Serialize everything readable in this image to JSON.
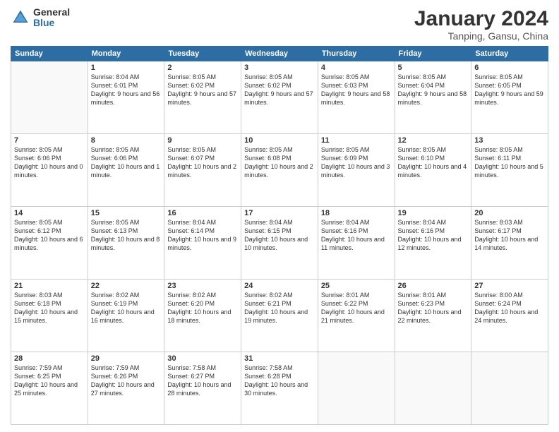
{
  "logo": {
    "general": "General",
    "blue": "Blue"
  },
  "title": "January 2024",
  "location": "Tanping, Gansu, China",
  "days_of_week": [
    "Sunday",
    "Monday",
    "Tuesday",
    "Wednesday",
    "Thursday",
    "Friday",
    "Saturday"
  ],
  "weeks": [
    [
      {
        "day": "",
        "sunrise": "",
        "sunset": "",
        "daylight": ""
      },
      {
        "day": "1",
        "sunrise": "Sunrise: 8:04 AM",
        "sunset": "Sunset: 6:01 PM",
        "daylight": "Daylight: 9 hours and 56 minutes."
      },
      {
        "day": "2",
        "sunrise": "Sunrise: 8:05 AM",
        "sunset": "Sunset: 6:02 PM",
        "daylight": "Daylight: 9 hours and 57 minutes."
      },
      {
        "day": "3",
        "sunrise": "Sunrise: 8:05 AM",
        "sunset": "Sunset: 6:02 PM",
        "daylight": "Daylight: 9 hours and 57 minutes."
      },
      {
        "day": "4",
        "sunrise": "Sunrise: 8:05 AM",
        "sunset": "Sunset: 6:03 PM",
        "daylight": "Daylight: 9 hours and 58 minutes."
      },
      {
        "day": "5",
        "sunrise": "Sunrise: 8:05 AM",
        "sunset": "Sunset: 6:04 PM",
        "daylight": "Daylight: 9 hours and 58 minutes."
      },
      {
        "day": "6",
        "sunrise": "Sunrise: 8:05 AM",
        "sunset": "Sunset: 6:05 PM",
        "daylight": "Daylight: 9 hours and 59 minutes."
      }
    ],
    [
      {
        "day": "7",
        "sunrise": "Sunrise: 8:05 AM",
        "sunset": "Sunset: 6:06 PM",
        "daylight": "Daylight: 10 hours and 0 minutes."
      },
      {
        "day": "8",
        "sunrise": "Sunrise: 8:05 AM",
        "sunset": "Sunset: 6:06 PM",
        "daylight": "Daylight: 10 hours and 1 minute."
      },
      {
        "day": "9",
        "sunrise": "Sunrise: 8:05 AM",
        "sunset": "Sunset: 6:07 PM",
        "daylight": "Daylight: 10 hours and 2 minutes."
      },
      {
        "day": "10",
        "sunrise": "Sunrise: 8:05 AM",
        "sunset": "Sunset: 6:08 PM",
        "daylight": "Daylight: 10 hours and 2 minutes."
      },
      {
        "day": "11",
        "sunrise": "Sunrise: 8:05 AM",
        "sunset": "Sunset: 6:09 PM",
        "daylight": "Daylight: 10 hours and 3 minutes."
      },
      {
        "day": "12",
        "sunrise": "Sunrise: 8:05 AM",
        "sunset": "Sunset: 6:10 PM",
        "daylight": "Daylight: 10 hours and 4 minutes."
      },
      {
        "day": "13",
        "sunrise": "Sunrise: 8:05 AM",
        "sunset": "Sunset: 6:11 PM",
        "daylight": "Daylight: 10 hours and 5 minutes."
      }
    ],
    [
      {
        "day": "14",
        "sunrise": "Sunrise: 8:05 AM",
        "sunset": "Sunset: 6:12 PM",
        "daylight": "Daylight: 10 hours and 6 minutes."
      },
      {
        "day": "15",
        "sunrise": "Sunrise: 8:05 AM",
        "sunset": "Sunset: 6:13 PM",
        "daylight": "Daylight: 10 hours and 8 minutes."
      },
      {
        "day": "16",
        "sunrise": "Sunrise: 8:04 AM",
        "sunset": "Sunset: 6:14 PM",
        "daylight": "Daylight: 10 hours and 9 minutes."
      },
      {
        "day": "17",
        "sunrise": "Sunrise: 8:04 AM",
        "sunset": "Sunset: 6:15 PM",
        "daylight": "Daylight: 10 hours and 10 minutes."
      },
      {
        "day": "18",
        "sunrise": "Sunrise: 8:04 AM",
        "sunset": "Sunset: 6:16 PM",
        "daylight": "Daylight: 10 hours and 11 minutes."
      },
      {
        "day": "19",
        "sunrise": "Sunrise: 8:04 AM",
        "sunset": "Sunset: 6:16 PM",
        "daylight": "Daylight: 10 hours and 12 minutes."
      },
      {
        "day": "20",
        "sunrise": "Sunrise: 8:03 AM",
        "sunset": "Sunset: 6:17 PM",
        "daylight": "Daylight: 10 hours and 14 minutes."
      }
    ],
    [
      {
        "day": "21",
        "sunrise": "Sunrise: 8:03 AM",
        "sunset": "Sunset: 6:18 PM",
        "daylight": "Daylight: 10 hours and 15 minutes."
      },
      {
        "day": "22",
        "sunrise": "Sunrise: 8:02 AM",
        "sunset": "Sunset: 6:19 PM",
        "daylight": "Daylight: 10 hours and 16 minutes."
      },
      {
        "day": "23",
        "sunrise": "Sunrise: 8:02 AM",
        "sunset": "Sunset: 6:20 PM",
        "daylight": "Daylight: 10 hours and 18 minutes."
      },
      {
        "day": "24",
        "sunrise": "Sunrise: 8:02 AM",
        "sunset": "Sunset: 6:21 PM",
        "daylight": "Daylight: 10 hours and 19 minutes."
      },
      {
        "day": "25",
        "sunrise": "Sunrise: 8:01 AM",
        "sunset": "Sunset: 6:22 PM",
        "daylight": "Daylight: 10 hours and 21 minutes."
      },
      {
        "day": "26",
        "sunrise": "Sunrise: 8:01 AM",
        "sunset": "Sunset: 6:23 PM",
        "daylight": "Daylight: 10 hours and 22 minutes."
      },
      {
        "day": "27",
        "sunrise": "Sunrise: 8:00 AM",
        "sunset": "Sunset: 6:24 PM",
        "daylight": "Daylight: 10 hours and 24 minutes."
      }
    ],
    [
      {
        "day": "28",
        "sunrise": "Sunrise: 7:59 AM",
        "sunset": "Sunset: 6:25 PM",
        "daylight": "Daylight: 10 hours and 25 minutes."
      },
      {
        "day": "29",
        "sunrise": "Sunrise: 7:59 AM",
        "sunset": "Sunset: 6:26 PM",
        "daylight": "Daylight: 10 hours and 27 minutes."
      },
      {
        "day": "30",
        "sunrise": "Sunrise: 7:58 AM",
        "sunset": "Sunset: 6:27 PM",
        "daylight": "Daylight: 10 hours and 28 minutes."
      },
      {
        "day": "31",
        "sunrise": "Sunrise: 7:58 AM",
        "sunset": "Sunset: 6:28 PM",
        "daylight": "Daylight: 10 hours and 30 minutes."
      },
      {
        "day": "",
        "sunrise": "",
        "sunset": "",
        "daylight": ""
      },
      {
        "day": "",
        "sunrise": "",
        "sunset": "",
        "daylight": ""
      },
      {
        "day": "",
        "sunrise": "",
        "sunset": "",
        "daylight": ""
      }
    ]
  ]
}
